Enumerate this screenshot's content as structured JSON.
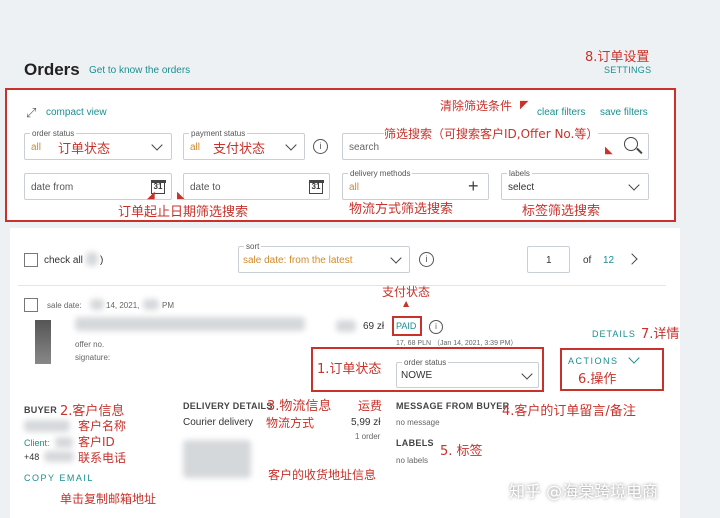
{
  "header": {
    "title": "Orders",
    "link": "Get to know the orders",
    "settings_annotation": "8.订单设置",
    "settings_label": "SETTINGS"
  },
  "filters": {
    "compact_view": "compact view",
    "clear_annotation": "清除筛选条件",
    "clear_filters": "clear filters",
    "save_filters": "save filters",
    "order_status": {
      "label": "order status",
      "value": "all",
      "annotation": "订单状态"
    },
    "payment_status": {
      "label": "payment status",
      "value": "all",
      "annotation": "支付状态"
    },
    "search": {
      "placeholder": "search",
      "annotation": "筛选搜索（可搜索客户ID,Offer No.等）"
    },
    "date_from": {
      "placeholder": "date from"
    },
    "date_to": {
      "placeholder": "date to"
    },
    "calendar_day": "31",
    "date_annotation": "订单起止日期筛选搜索",
    "delivery": {
      "label": "delivery methods",
      "value": "all",
      "annotation": "物流方式筛选搜索"
    },
    "labels": {
      "label": "labels",
      "value": "select",
      "annotation": "标签筛选搜索"
    }
  },
  "toolbar": {
    "check_all": "check all",
    "check_all_suffix": ")",
    "sort_label": "sort",
    "sort_value": "sale date: from the latest",
    "page": "1",
    "of": "of",
    "total_pages": "12"
  },
  "order": {
    "sale_date_label": "sale date:",
    "sale_date_value": "14, 2021,",
    "sale_time_suffix": "PM",
    "payment_annotation": "支付状态",
    "price": "69 zł",
    "paid": "PAID",
    "paid_detail": "17, 68 PLN （Jan 14, 2021, 3:39 PM）",
    "offer_no": "offer no.",
    "signature": "signature:",
    "details": "DETAILS",
    "details_annotation": "7.详情",
    "order_status_annotation": "1.订单状态",
    "order_status_label": "order status",
    "order_status_value": "NOWE",
    "actions": "ACTIONS",
    "actions_annotation": "6.操作",
    "buyer": "BUYER",
    "buyer_annotation": "2.客户信息",
    "client_label": "Client:",
    "phone_prefix": "+48",
    "name_annotation": "客户名称",
    "id_annotation": "客户ID",
    "phone_annotation": "联系电话",
    "copy_email": "COPY EMAIL",
    "copy_annotation": "单击复制邮箱地址",
    "delivery_details": "DELIVERY DETAILS",
    "delivery_annotation": "3.物流信息",
    "courier": "Courier delivery",
    "courier_annotation": "物流方式",
    "freight_annotation": "运费",
    "freight": "5,99 zł",
    "freight_count": "1 order",
    "address_annotation": "客户的收货地址信息",
    "message_header": "MESSAGE FROM BUYER",
    "message_annotation": "4.客户的订单留言/备注",
    "no_message": "no message",
    "labels_header": "LABELS",
    "labels_annotation": "5. 标签",
    "no_labels": "no labels"
  },
  "watermark": "知乎 @海棠跨境电商"
}
